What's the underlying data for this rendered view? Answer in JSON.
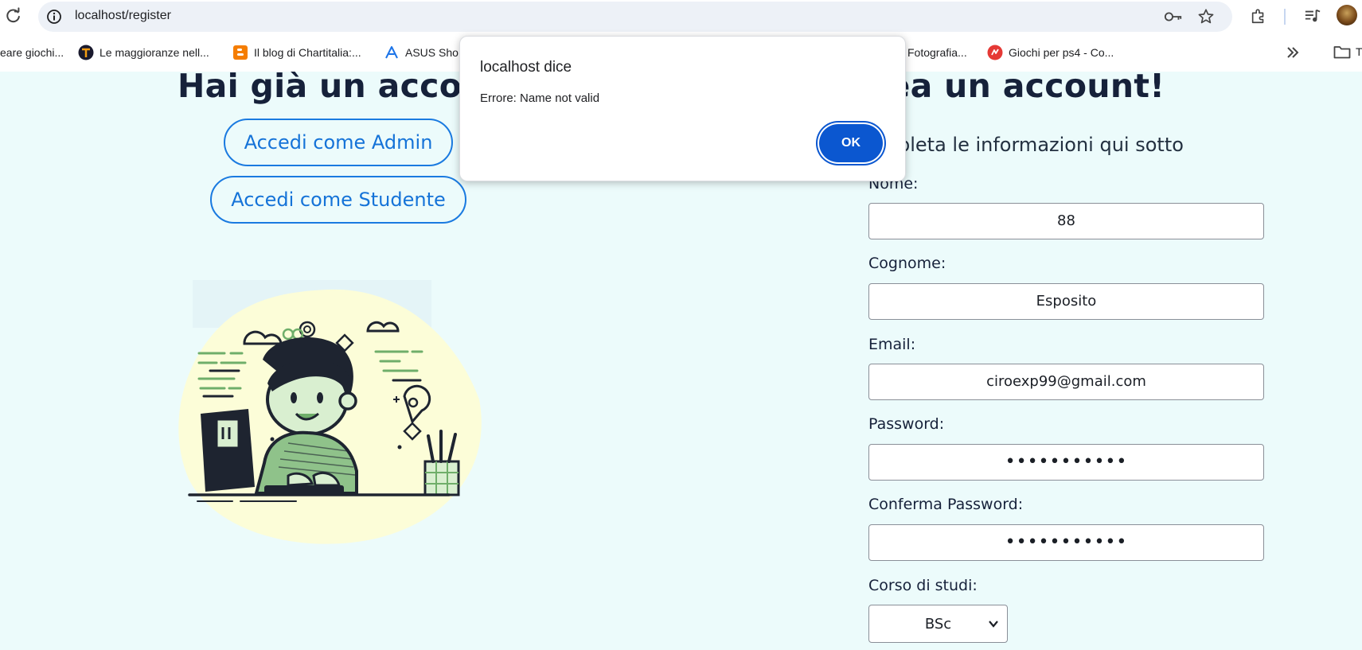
{
  "browser": {
    "url": "localhost/register",
    "bookmarks": [
      {
        "label": "eare giochi...",
        "icon": "none",
        "color": ""
      },
      {
        "label": "Le maggioranze nell...",
        "icon": "tp-logo-icon",
        "color": "#f39c12"
      },
      {
        "label": "Il blog di Chartitalia:...",
        "icon": "blogger-icon",
        "color": "#f57d00"
      },
      {
        "label": "ASUS Sho",
        "icon": "asus-icon",
        "color": "#1a73e8"
      },
      {
        "label": "Fotografia...",
        "icon": "none",
        "color": ""
      },
      {
        "label": "Giochi per ps4 - Co...",
        "icon": "red-site-icon",
        "color": "#e53935"
      }
    ],
    "folder_label": "T"
  },
  "page": {
    "left_heading": "Hai già un accoun",
    "right_heading": "rea un account!",
    "admin_button": "Accedi come Admin",
    "student_button": "Accedi come Studente",
    "form_subtitle": "pleta le informazioni qui sotto",
    "form": {
      "name_label": "Nome:",
      "name_value": "88",
      "surname_label": "Cognome:",
      "surname_value": "Esposito",
      "email_label": "Email:",
      "email_value": "ciroexp99@gmail.com",
      "password_label": "Password:",
      "password_value": "•••••••••••",
      "confirm_label": "Conferma Password:",
      "confirm_value": "•••••••••••",
      "course_label": "Corso di studi:",
      "course_value": "BSc"
    }
  },
  "dialog": {
    "title": "localhost dice",
    "message": "Errore: Name not valid",
    "ok_label": "OK"
  },
  "colors": {
    "page_bg": "#ecfbfb",
    "accent_blue": "#1a7ae0",
    "dialog_ok": "#0b57d0",
    "illustration_blob": "#fcfdd8",
    "illustration_green": "#6fae6a"
  }
}
